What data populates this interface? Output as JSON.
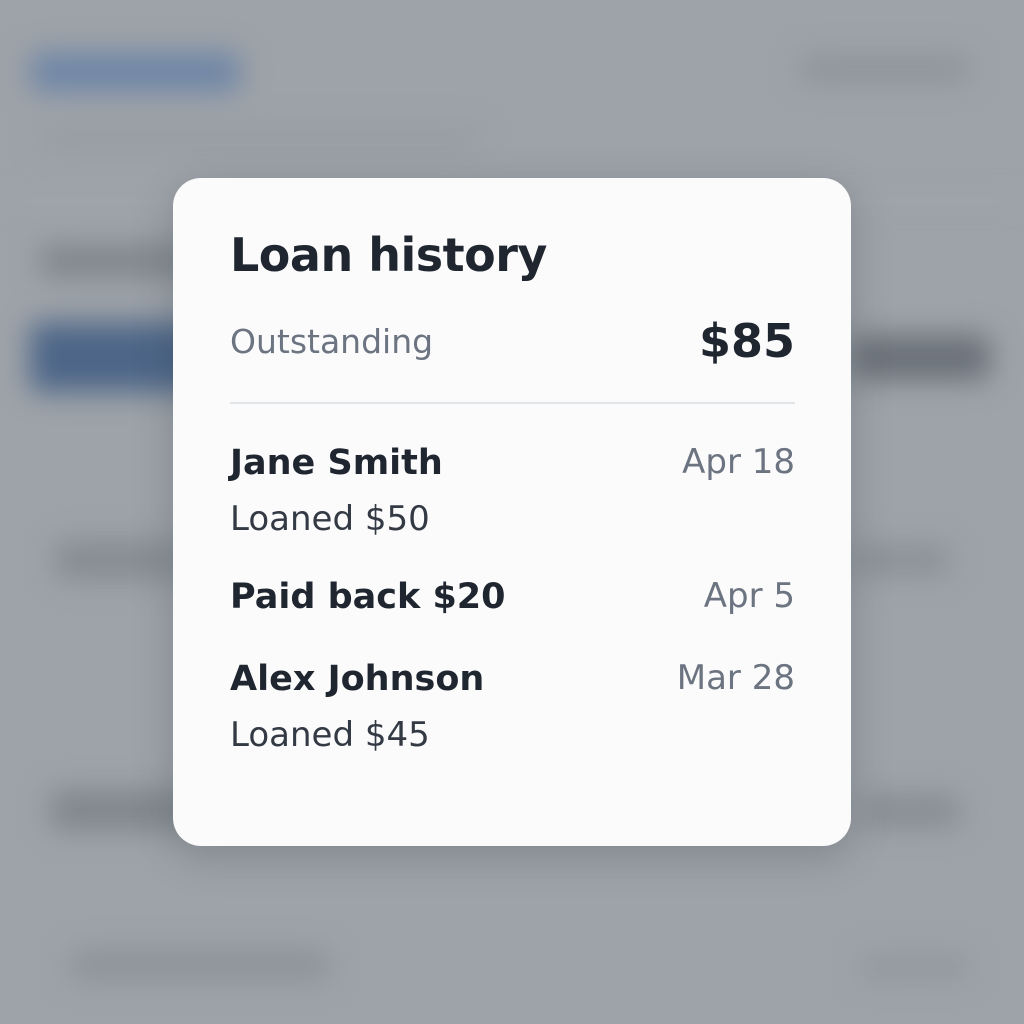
{
  "card": {
    "title": "Loan history",
    "summary": {
      "label": "Outstanding",
      "amount": "$85"
    },
    "entries": [
      {
        "title": "Jane Smith",
        "detail": "Loaned $50",
        "date": "Apr 18"
      },
      {
        "title": "Paid back $20",
        "detail": "",
        "date": "Apr 5"
      },
      {
        "title": "Alex Johnson",
        "detail": "Loaned $45",
        "date": "Mar 28"
      }
    ]
  },
  "colors": {
    "card_background": "#fbfbfc",
    "primary_text": "#1f2630",
    "secondary_text": "#6b7480",
    "backdrop": "#9ea3a9"
  }
}
